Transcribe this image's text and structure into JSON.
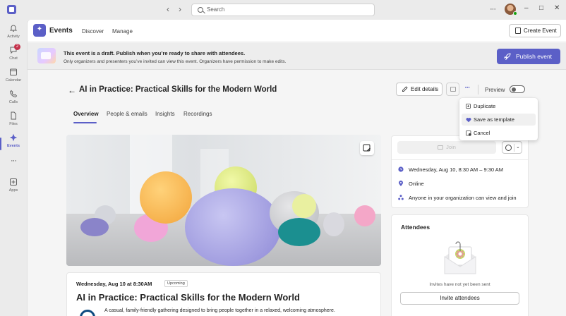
{
  "window": {
    "search_placeholder": "Search",
    "nav_back": "‹",
    "nav_forward": "›",
    "more": "···",
    "minimize": "–",
    "maximize": "□",
    "close": "✕"
  },
  "rail": {
    "items": [
      {
        "label": "Activity",
        "icon": "bell-icon"
      },
      {
        "label": "Chat",
        "icon": "chat-icon",
        "badge": "2"
      },
      {
        "label": "Calendar",
        "icon": "calendar-icon"
      },
      {
        "label": "Calls",
        "icon": "phone-icon"
      },
      {
        "label": "Files",
        "icon": "file-icon"
      },
      {
        "label": "Events",
        "icon": "events-icon"
      },
      {
        "label": "···",
        "icon": "more-icon"
      },
      {
        "label": "Apps",
        "icon": "apps-icon"
      }
    ]
  },
  "header": {
    "app_title": "Events",
    "tabs": [
      "Discover",
      "Manage"
    ],
    "create_label": "Create Event"
  },
  "banner": {
    "title": "This event is a draft. Publish when you’re ready to share with attendees.",
    "subtitle": "Only organizers and presenters you’ve invited can view this event. Organizers have permission to make edits.",
    "publish_label": "Publish event"
  },
  "event": {
    "title": "AI in Practice: Practical Skills for the Modern World",
    "edit_label": "Edit details",
    "preview_label": "Preview",
    "preview_on": false,
    "tabs": [
      "Overview",
      "People & emails",
      "Insights",
      "Recordings"
    ],
    "active_tab": "Overview"
  },
  "menu": {
    "items": [
      {
        "label": "Duplicate",
        "icon": "duplicate-icon"
      },
      {
        "label": "Save as template",
        "icon": "heart-icon"
      },
      {
        "label": "Cancel",
        "icon": "calendar-cancel-icon"
      }
    ]
  },
  "card": {
    "date_line": "Wednesday, Aug 10 at 8:30AM",
    "status_badge": "Upcoming",
    "title": "AI in Practice: Practical Skills for the Modern World",
    "description": "A casual, family-friendly gathering designed to bring people together in a relaxed, welcoming atmosphere."
  },
  "info": {
    "join_label": "Join",
    "when": "Wednesday, Aug 10, 8:30 AM – 9:30 AM",
    "location": "Online",
    "visibility": "Anyone in your organization can view and join"
  },
  "attendees": {
    "title": "Attendees",
    "empty_text": "Invites have not yet been sent",
    "invite_label": "Invite attendees"
  },
  "colors": {
    "brand": "#5b5fc7",
    "badge_red": "#c4314b"
  }
}
